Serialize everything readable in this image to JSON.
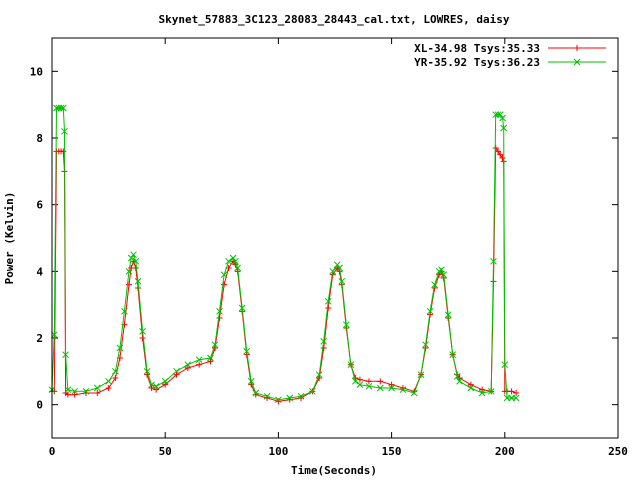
{
  "chart_data": {
    "type": "line",
    "title": "Skynet_57883_3C123_28083_28443_cal.txt, LOWRES, daisy",
    "xlabel": "Time(Seconds)",
    "ylabel": "Power (Kelvin)",
    "xlim": [
      0,
      250
    ],
    "ylim": [
      -1,
      11
    ],
    "xticks": [
      0,
      50,
      100,
      150,
      200,
      250
    ],
    "yticks": [
      0,
      2,
      4,
      6,
      8,
      10
    ],
    "grid": false,
    "legend_position": "top-right",
    "series": [
      {
        "name": "XL-34.98 Tsys:35.33",
        "color": "#ff0000",
        "marker": "plus",
        "x": [
          0,
          1,
          2,
          3,
          4,
          5,
          5.5,
          6,
          7,
          10,
          15,
          20,
          25,
          28,
          30,
          32,
          34,
          35,
          36,
          37,
          38,
          40,
          42,
          44,
          46,
          50,
          55,
          60,
          65,
          70,
          72,
          74,
          76,
          78,
          80,
          81,
          82,
          84,
          86,
          88,
          90,
          95,
          100,
          105,
          110,
          115,
          118,
          120,
          122,
          124,
          126,
          127,
          128,
          130,
          132,
          134,
          136,
          140,
          145,
          150,
          155,
          160,
          163,
          165,
          167,
          169,
          171,
          172,
          173,
          175,
          177,
          179,
          180,
          185,
          190,
          194,
          195,
          196,
          197,
          198,
          199,
          199.5,
          200,
          201,
          203,
          205
        ],
        "y": [
          0.4,
          0.4,
          7.6,
          7.6,
          7.6,
          7.6,
          7.0,
          0.35,
          0.3,
          0.3,
          0.35,
          0.35,
          0.5,
          0.8,
          1.4,
          2.4,
          3.6,
          4.1,
          4.3,
          4.1,
          3.5,
          2.0,
          0.9,
          0.5,
          0.45,
          0.6,
          0.9,
          1.1,
          1.2,
          1.3,
          1.7,
          2.6,
          3.6,
          4.1,
          4.3,
          4.2,
          4.0,
          2.8,
          1.5,
          0.6,
          0.3,
          0.2,
          0.1,
          0.15,
          0.2,
          0.4,
          0.8,
          1.7,
          2.9,
          3.9,
          4.1,
          4.0,
          3.6,
          2.3,
          1.2,
          0.8,
          0.75,
          0.7,
          0.7,
          0.6,
          0.5,
          0.4,
          0.9,
          1.7,
          2.7,
          3.5,
          3.9,
          4.0,
          3.8,
          2.6,
          1.5,
          0.9,
          0.8,
          0.6,
          0.45,
          0.4,
          3.7,
          7.7,
          7.6,
          7.5,
          7.4,
          7.3,
          0.4,
          0.4,
          0.4,
          0.35
        ]
      },
      {
        "name": "YR-35.92 Tsys:36.23",
        "color": "#00c000",
        "marker": "cross",
        "x": [
          0,
          1,
          2,
          3,
          4,
          5,
          5.5,
          6,
          7,
          10,
          15,
          20,
          25,
          28,
          30,
          32,
          34,
          35,
          36,
          37,
          38,
          40,
          42,
          44,
          46,
          50,
          55,
          60,
          65,
          70,
          72,
          74,
          76,
          78,
          80,
          81,
          82,
          84,
          86,
          88,
          90,
          95,
          100,
          105,
          110,
          115,
          118,
          120,
          122,
          124,
          126,
          127,
          128,
          130,
          132,
          134,
          136,
          140,
          145,
          150,
          155,
          160,
          163,
          165,
          167,
          169,
          171,
          172,
          173,
          175,
          177,
          179,
          180,
          185,
          190,
          194,
          195,
          196,
          197,
          198,
          199,
          199.5,
          200,
          201,
          203,
          205
        ],
        "y": [
          0.45,
          2.1,
          8.9,
          8.9,
          8.9,
          8.9,
          8.2,
          1.5,
          0.45,
          0.4,
          0.4,
          0.5,
          0.7,
          1.0,
          1.7,
          2.8,
          4.0,
          4.4,
          4.5,
          4.3,
          3.7,
          2.2,
          1.0,
          0.6,
          0.55,
          0.7,
          1.0,
          1.2,
          1.35,
          1.4,
          1.8,
          2.8,
          3.9,
          4.3,
          4.4,
          4.3,
          4.1,
          2.9,
          1.6,
          0.7,
          0.35,
          0.25,
          0.15,
          0.2,
          0.25,
          0.4,
          0.9,
          1.9,
          3.1,
          4.0,
          4.2,
          4.1,
          3.7,
          2.4,
          1.2,
          0.7,
          0.6,
          0.55,
          0.5,
          0.5,
          0.45,
          0.35,
          0.9,
          1.8,
          2.8,
          3.6,
          4.0,
          4.05,
          3.9,
          2.7,
          1.5,
          0.85,
          0.7,
          0.5,
          0.35,
          0.4,
          4.3,
          8.7,
          8.7,
          8.7,
          8.6,
          8.3,
          1.2,
          0.2,
          0.2,
          0.2
        ]
      }
    ]
  }
}
